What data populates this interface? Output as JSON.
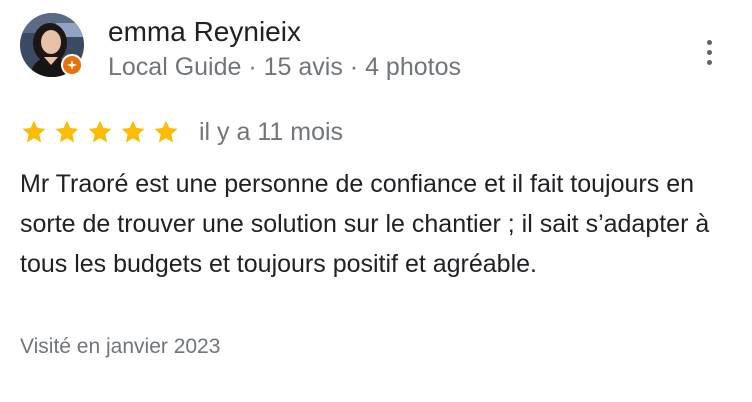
{
  "reviewer": {
    "name": "emma Reynieix",
    "meta": "Local Guide · 15 avis · 4 photos",
    "avatar_icon": "profile-photo",
    "badge_icon": "local-guide-star-icon",
    "badge_color": "#e8710a"
  },
  "menu": {
    "icon": "more-vertical-icon"
  },
  "rating": {
    "stars": 5,
    "max_stars": 5,
    "star_color": "#fbbc04",
    "date": "il y a 11 mois"
  },
  "review": {
    "text": "Mr Traoré est une personne de confiance et il fait toujours en sorte de trouver une solution sur le chantier ; il sait s’adapter à tous les budgets et toujours positif et agréable.",
    "visit": "Visité en janvier 2023"
  }
}
